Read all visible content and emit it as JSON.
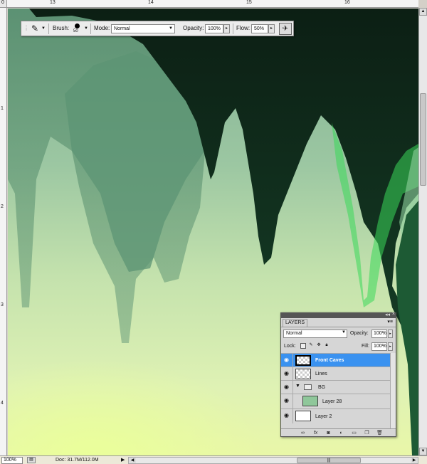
{
  "rulers": {
    "top_labels": [
      "13",
      "14",
      "15",
      "16"
    ],
    "left_labels": [
      "1",
      "2",
      "3",
      "4"
    ],
    "corner_label": "0"
  },
  "options_bar": {
    "brush_label": "Brush:",
    "brush_size": "50",
    "mode_label": "Mode:",
    "mode_value": "Normal",
    "opacity_label": "Opacity:",
    "opacity_value": "100%",
    "flow_label": "Flow:",
    "flow_value": "50%"
  },
  "status_bar": {
    "zoom": "100%",
    "doc_info": "Doc: 31.7M/112.0M"
  },
  "layers_panel": {
    "tab_label": "LAYERS",
    "blend_mode": "Normal",
    "opacity_label": "Opacity:",
    "opacity_value": "100%",
    "lock_label": "Lock:",
    "fill_label": "Fill:",
    "fill_value": "100%",
    "layers": [
      {
        "name": "Front Caves",
        "active": true
      },
      {
        "name": "Lines",
        "active": false
      },
      {
        "name": "BG",
        "active": false
      },
      {
        "name": "Layer 28",
        "active": false
      },
      {
        "name": "Layer 2",
        "active": false
      }
    ]
  },
  "icons": {
    "brush_tool": "brush-icon",
    "airbrush": "airbrush-icon",
    "eye": "eye-icon",
    "folder": "folder-icon",
    "link": "link-icon",
    "fx": "fx-icon",
    "mask": "mask-icon",
    "adjustment": "adjustment-icon",
    "group": "new-group-icon",
    "new_layer": "new-layer-icon",
    "trash": "trash-icon"
  },
  "colors": {
    "canvas_light": "#dff0bf",
    "cave_dark": "#0f2a1a",
    "cave_mid": "#4f8a6a",
    "accent_green": "#3fe05a",
    "selection_blue": "#3a92f0"
  }
}
